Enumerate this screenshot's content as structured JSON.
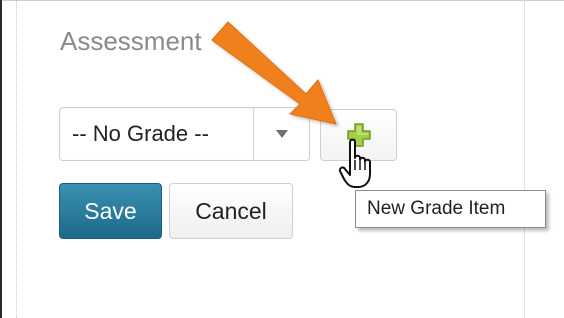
{
  "section": {
    "heading": "Assessment"
  },
  "grade_select": {
    "selected": "-- No Grade --"
  },
  "add_button": {
    "tooltip": "New Grade Item",
    "icon": "plus-icon"
  },
  "actions": {
    "save_label": "Save",
    "cancel_label": "Cancel"
  },
  "colors": {
    "save_bg": "#1c6a8c",
    "plus_icon": "#9bc53d",
    "arrow": "#f07f1a"
  }
}
